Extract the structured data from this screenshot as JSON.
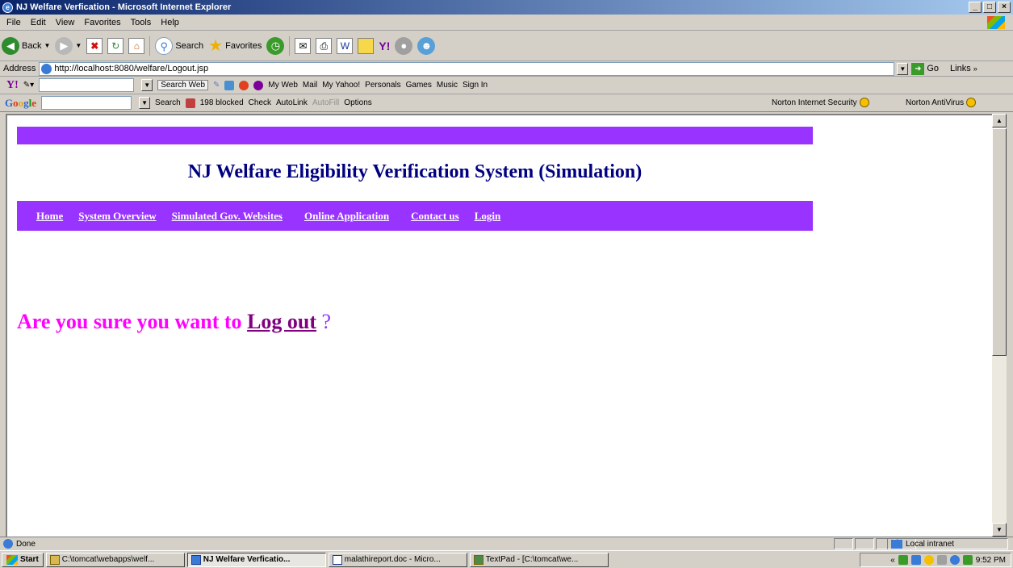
{
  "window": {
    "title": "NJ Welfare Verfication - Microsoft Internet Explorer",
    "buttons": [
      "_",
      "□",
      "×"
    ]
  },
  "menu": [
    "File",
    "Edit",
    "View",
    "Favorites",
    "Tools",
    "Help"
  ],
  "toolbar": {
    "back": "Back",
    "search": "Search",
    "favorites": "Favorites"
  },
  "address": {
    "label": "Address",
    "url": "http://localhost:8080/welfare/Logout.jsp",
    "go": "Go",
    "links": "Links"
  },
  "yahoo": {
    "search_web": "Search Web",
    "my_web": "My Web",
    "mail": "Mail",
    "my_yahoo": "My Yahoo!",
    "personals": "Personals",
    "games": "Games",
    "music": "Music",
    "sign_in": "Sign In"
  },
  "google": {
    "search": "Search",
    "blocked": "198 blocked",
    "check": "Check",
    "autolink": "AutoLink",
    "autofill": "AutoFill",
    "options": "Options",
    "norton_security": "Norton Internet Security",
    "norton_antivirus": "Norton AntiVirus"
  },
  "page": {
    "title": "NJ Welfare Eligibility Verification System (Simulation)",
    "nav": [
      "Home",
      "System Overview",
      "Simulated Gov. Websites",
      "Online Application",
      "Contact us",
      "Login"
    ],
    "question_prefix": "Are you sure you want to ",
    "logout_link": "Log out",
    "question_suffix": " ?",
    "colors": {
      "band": "#9933ff",
      "title": "#000080",
      "question": "#ff00ff",
      "link": "#800080"
    }
  },
  "status": {
    "text": "Done",
    "zone": "Local intranet"
  },
  "taskbar": {
    "start": "Start",
    "tasks": [
      "C:\\tomcat\\webapps\\welf...",
      "NJ Welfare Verficatio...",
      "malathireport.doc - Micro...",
      "TextPad - [C:\\tomcat\\we..."
    ],
    "active_index": 1,
    "clock": "9:52 PM"
  }
}
